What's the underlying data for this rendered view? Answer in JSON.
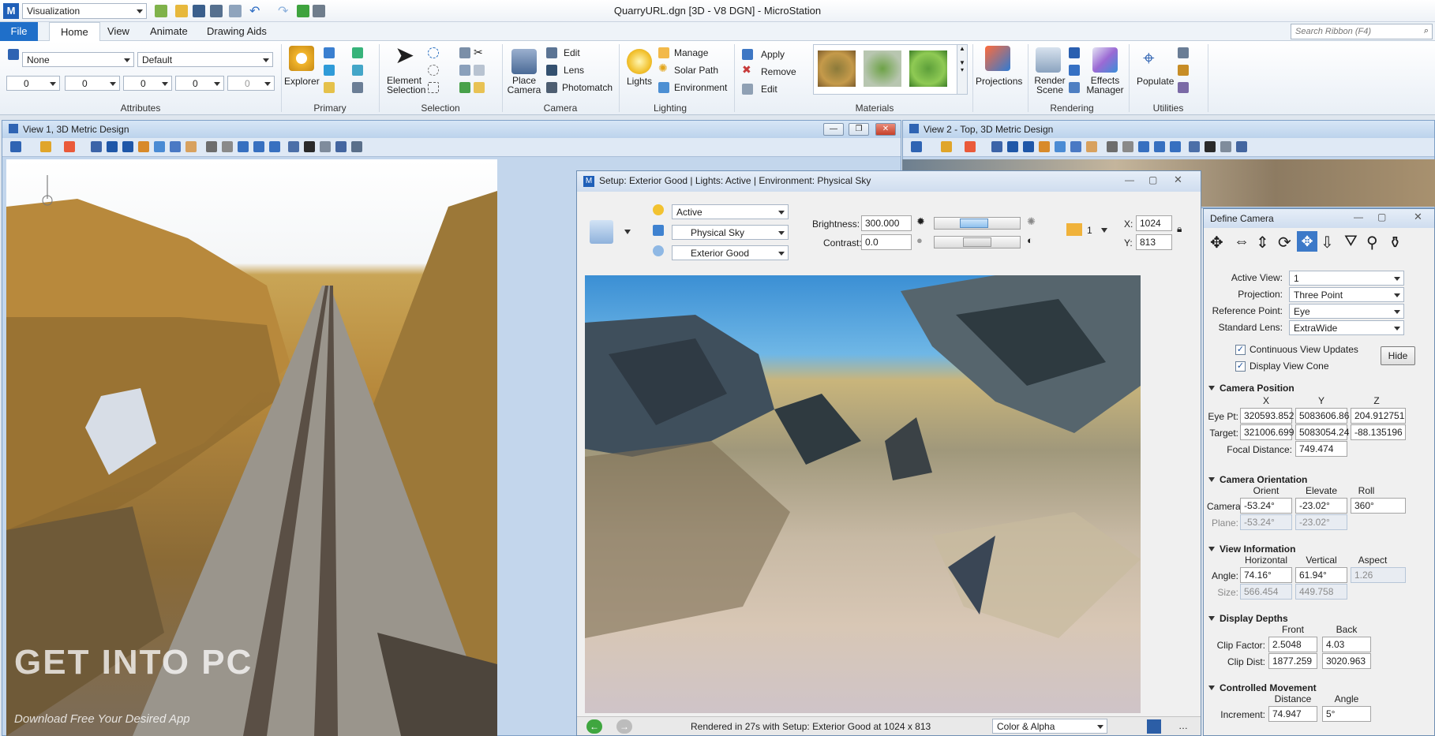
{
  "titlebar": {
    "workflow": "Visualization",
    "window_title": "QuarryURL.dgn [3D - V8 DGN] - MicroStation"
  },
  "tabs": [
    "File",
    "Home",
    "View",
    "Animate",
    "Drawing Aids"
  ],
  "search": {
    "placeholder": "Search Ribbon (F4)"
  },
  "ribbon": {
    "attributes": {
      "label": "Attributes",
      "level": "None",
      "style": "Default",
      "color": "0",
      "weight": "0",
      "line_style": "0",
      "class": "0",
      "transparency": "0"
    },
    "primary": {
      "label": "Primary",
      "explorer": "Explorer"
    },
    "selection": {
      "label": "Selection",
      "element": "Element",
      "selection": "Selection"
    },
    "camera": {
      "label": "Camera",
      "place": "Place",
      "camera": "Camera",
      "edit": "Edit",
      "lens": "Lens",
      "photomatch": "Photomatch"
    },
    "lighting": {
      "label": "Lighting",
      "lights": "Lights",
      "manage": "Manage",
      "solar_path": "Solar Path",
      "environment": "Environment"
    },
    "materials": {
      "label": "Materials",
      "apply": "Apply",
      "remove": "Remove",
      "edit": "Edit"
    },
    "projections": {
      "label": "Projections"
    },
    "rendering": {
      "label": "Rendering",
      "render": "Render",
      "scene": "Scene",
      "effects": "Effects",
      "manager": "Manager"
    },
    "utilities": {
      "label": "Utilities",
      "populate": "Populate"
    }
  },
  "view1": {
    "title": "View 1, 3D Metric Design"
  },
  "view2": {
    "title": "View 2 - Top, 3D Metric Design"
  },
  "setup": {
    "title": "Setup: Exterior Good | Lights: Active | Environment: Physical Sky",
    "lights": "Active",
    "environment": "Physical Sky",
    "setup": "Exterior Good",
    "brightness_label": "Brightness:",
    "brightness": "300.000",
    "contrast_label": "Contrast:",
    "contrast": "0.0",
    "view_number": "1",
    "x_label": "X:",
    "x": "1024",
    "y_label": "Y:",
    "y": "813",
    "status": "Rendered in 27s with Setup: Exterior Good at 1024 x 813",
    "output": "Color & Alpha"
  },
  "camera": {
    "title": "Define Camera",
    "active_view_label": "Active View:",
    "active_view": "1",
    "projection_label": "Projection:",
    "projection": "Three Point",
    "reference_label": "Reference Point:",
    "reference": "Eye",
    "lens_label": "Standard Lens:",
    "lens": "ExtraWide",
    "continuous": "Continuous View Updates",
    "display_cone": "Display View Cone",
    "hide": "Hide",
    "position": {
      "header": "Camera Position",
      "x": "X",
      "y": "Y",
      "z": "Z",
      "eye_label": "Eye Pt:",
      "eye": [
        "320593.852",
        "5083606.86",
        "204.912751"
      ],
      "target_label": "Target:",
      "target": [
        "321006.699",
        "5083054.24",
        "-88.135196"
      ],
      "focal_label": "Focal Distance:",
      "focal": "749.474"
    },
    "orientation": {
      "header": "Camera Orientation",
      "orient": "Orient",
      "elevate": "Elevate",
      "roll": "Roll",
      "camera_label": "Camera:",
      "camera": [
        "-53.24°",
        "-23.02°",
        "360°"
      ],
      "plane_label": "Plane:",
      "plane": [
        "-53.24°",
        "-23.02°"
      ]
    },
    "view_info": {
      "header": "View Information",
      "horizontal": "Horizontal",
      "vertical": "Vertical",
      "aspect": "Aspect",
      "angle_label": "Angle:",
      "angle": [
        "74.16°",
        "61.94°",
        "1.26"
      ],
      "size_label": "Size:",
      "size": [
        "566.454",
        "449.758"
      ]
    },
    "depths": {
      "header": "Display Depths",
      "front": "Front",
      "back": "Back",
      "clip_factor_label": "Clip Factor:",
      "clip_factor": [
        "2.5048",
        "4.03"
      ],
      "clip_dist_label": "Clip Dist:",
      "clip_dist": [
        "1877.259",
        "3020.963"
      ]
    },
    "movement": {
      "header": "Controlled Movement",
      "distance": "Distance",
      "angle": "Angle",
      "increment_label": "Increment:",
      "increment": [
        "74.947",
        "5°"
      ]
    }
  },
  "watermark": {
    "main": "GET INTO PC",
    "sub": "Download Free Your Desired App"
  },
  "colors": {
    "accent": "#1f6fc9",
    "title_bg": "#cfddef"
  }
}
